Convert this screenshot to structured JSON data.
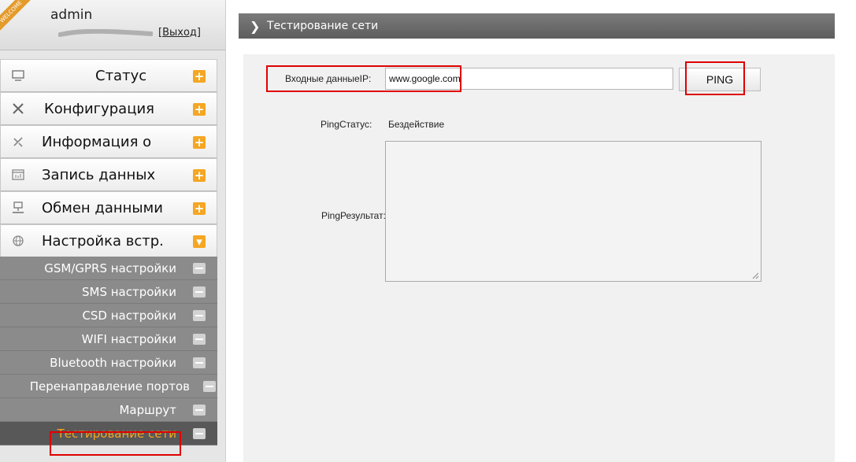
{
  "sidebar": {
    "welcome_ribbon": "WELCOME",
    "username": "admin",
    "logout_label": "[Выход]",
    "menu": [
      {
        "id": "status",
        "label": "Статус",
        "icon": "monitor-icon",
        "toggle": "+"
      },
      {
        "id": "config",
        "label": "Конфигурация",
        "icon": "tools-icon",
        "toggle": "+"
      },
      {
        "id": "info",
        "label": "Информация о",
        "icon": "satellite-icon",
        "toggle": "+"
      },
      {
        "id": "log",
        "label": "Запись данных",
        "icon": "calendar-icon",
        "toggle": "+"
      },
      {
        "id": "exchange",
        "label": "Обмен данными",
        "icon": "network-icon",
        "toggle": "+"
      },
      {
        "id": "settings",
        "label": "Настройка встр.",
        "icon": "globe-icon",
        "toggle": "▾"
      }
    ],
    "submenu": [
      {
        "id": "gsm",
        "label": "GSM/GPRS настройки"
      },
      {
        "id": "sms",
        "label": "SMS настройки"
      },
      {
        "id": "csd",
        "label": "CSD настройки"
      },
      {
        "id": "wifi",
        "label": "WIFI настройки"
      },
      {
        "id": "bluetooth",
        "label": "Bluetooth настройки"
      },
      {
        "id": "portfwd",
        "label": "Перенаправление портов"
      },
      {
        "id": "route",
        "label": "Маршрут"
      },
      {
        "id": "nettest",
        "label": "Тестирование сети",
        "active": true
      }
    ]
  },
  "main": {
    "title": "Тестирование сети",
    "ip_label": "Входные данныеIP:",
    "ip_value": "www.google.com",
    "ping_button": "PING",
    "status_label": "PingСтатус:",
    "status_value": "Бездействие",
    "result_label": "PingРезультат:",
    "result_value": ""
  },
  "colors": {
    "accent": "#f5a623",
    "highlight": "#e00000",
    "title_bar": "#6a6a6a",
    "submenu_bg": "#8b8b8b"
  }
}
